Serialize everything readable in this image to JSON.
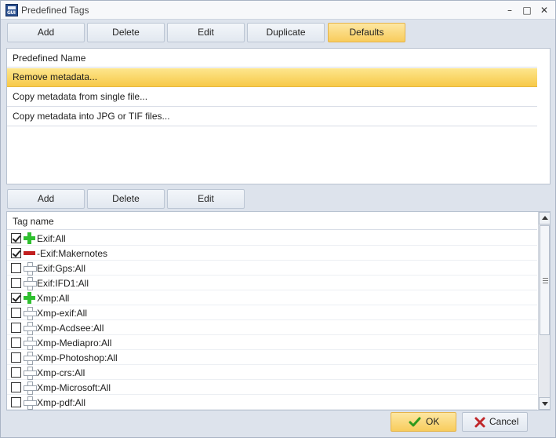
{
  "window": {
    "title": "Predefined Tags",
    "minimize": "–",
    "maximize": "□",
    "close": "✕"
  },
  "top_toolbar": {
    "buttons": [
      "Add",
      "Delete",
      "Edit",
      "Duplicate",
      "Defaults"
    ]
  },
  "predefined": {
    "header": "Predefined Name",
    "rows": [
      "Remove metadata...",
      "Copy metadata from single file...",
      "Copy metadata into JPG or TIF files..."
    ],
    "selected_index": 0
  },
  "mid_toolbar": {
    "buttons": [
      "Add",
      "Delete",
      "Edit"
    ]
  },
  "tags": {
    "header": "Tag name",
    "rows": [
      {
        "name": "Exif:All",
        "checked": true,
        "icon": "plus-green-icon"
      },
      {
        "name": "-Exif:Makernotes",
        "checked": true,
        "icon": "minus-red-icon"
      },
      {
        "name": "Exif:Gps:All",
        "checked": false,
        "icon": "plus-outline-icon"
      },
      {
        "name": "Exif:IFD1:All",
        "checked": false,
        "icon": "plus-outline-icon"
      },
      {
        "name": "Xmp:All",
        "checked": true,
        "icon": "plus-green-icon"
      },
      {
        "name": "Xmp-exif:All",
        "checked": false,
        "icon": "plus-outline-icon"
      },
      {
        "name": "Xmp-Acdsee:All",
        "checked": false,
        "icon": "plus-outline-icon"
      },
      {
        "name": "Xmp-Mediapro:All",
        "checked": false,
        "icon": "plus-outline-icon"
      },
      {
        "name": "Xmp-Photoshop:All",
        "checked": false,
        "icon": "plus-outline-icon"
      },
      {
        "name": "Xmp-crs:All",
        "checked": false,
        "icon": "plus-outline-icon"
      },
      {
        "name": "Xmp-Microsoft:All",
        "checked": false,
        "icon": "plus-outline-icon"
      },
      {
        "name": "Xmp-pdf:All",
        "checked": false,
        "icon": "plus-outline-icon"
      }
    ]
  },
  "dialog_buttons": {
    "ok": "OK",
    "cancel": "Cancel"
  },
  "colors": {
    "accent_gold": "#f8cc5c",
    "plus_green": "#2fbf2f",
    "minus_red": "#c21f1f",
    "cancel_x": "#c0282b"
  }
}
